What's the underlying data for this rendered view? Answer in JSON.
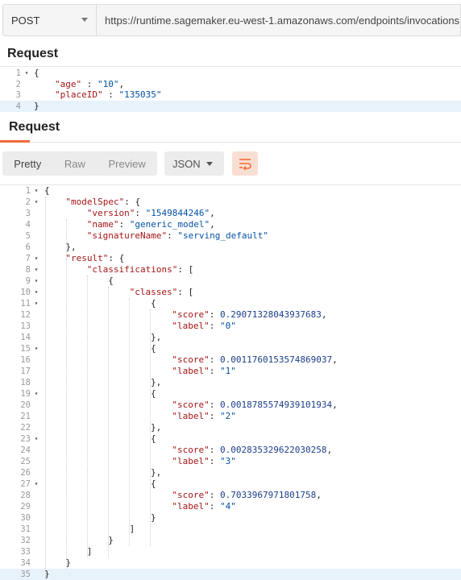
{
  "request_bar": {
    "method": "POST",
    "url": "https://runtime.sagemaker.eu-west-1.amazonaws.com/endpoints/invocations"
  },
  "request_section": {
    "heading": "Request",
    "lines": [
      {
        "num": "1",
        "fold": true,
        "text": "{"
      },
      {
        "num": "2",
        "fold": false,
        "key": "\"age\"",
        "sep": " : ",
        "val": "\"10\"",
        "tail": ","
      },
      {
        "num": "3",
        "fold": false,
        "key": "\"placeID\"",
        "sep": " : ",
        "val": "\"135035\"",
        "tail": ""
      },
      {
        "num": "4",
        "fold": false,
        "text": "}"
      }
    ]
  },
  "response_section": {
    "heading": "Request",
    "view_tabs": [
      "Pretty",
      "Raw",
      "Preview"
    ],
    "format": "JSON",
    "wrap_icon": "wrap-lines-icon",
    "accent_color": "#f26b3a",
    "lines": [
      {
        "num": "1",
        "fold": true,
        "indent": 0,
        "text": "{"
      },
      {
        "num": "2",
        "fold": true,
        "indent": 1,
        "key": "\"modelSpec\"",
        "sep": ": ",
        "text": "{"
      },
      {
        "num": "3",
        "fold": false,
        "indent": 2,
        "key": "\"version\"",
        "sep": ": ",
        "val": "\"1549844246\"",
        "tail": ","
      },
      {
        "num": "4",
        "fold": false,
        "indent": 2,
        "key": "\"name\"",
        "sep": ": ",
        "val": "\"generic_model\"",
        "tail": ","
      },
      {
        "num": "5",
        "fold": false,
        "indent": 2,
        "key": "\"signatureName\"",
        "sep": ": ",
        "val": "\"serving_default\"",
        "tail": ""
      },
      {
        "num": "6",
        "fold": false,
        "indent": 1,
        "text": "},"
      },
      {
        "num": "7",
        "fold": true,
        "indent": 1,
        "key": "\"result\"",
        "sep": ": ",
        "text": "{"
      },
      {
        "num": "8",
        "fold": true,
        "indent": 2,
        "key": "\"classifications\"",
        "sep": ": ",
        "text": "["
      },
      {
        "num": "9",
        "fold": true,
        "indent": 3,
        "text": "{"
      },
      {
        "num": "10",
        "fold": true,
        "indent": 4,
        "key": "\"classes\"",
        "sep": ": ",
        "text": "["
      },
      {
        "num": "11",
        "fold": true,
        "indent": 5,
        "text": "{"
      },
      {
        "num": "12",
        "fold": false,
        "indent": 6,
        "key": "\"score\"",
        "sep": ": ",
        "num_val": "0.29071328043937683",
        "tail": ","
      },
      {
        "num": "13",
        "fold": false,
        "indent": 6,
        "key": "\"label\"",
        "sep": ": ",
        "val": "\"0\"",
        "tail": ""
      },
      {
        "num": "14",
        "fold": false,
        "indent": 5,
        "text": "},"
      },
      {
        "num": "15",
        "fold": true,
        "indent": 5,
        "text": "{"
      },
      {
        "num": "16",
        "fold": false,
        "indent": 6,
        "key": "\"score\"",
        "sep": ": ",
        "num_val": "0.0011760153574869037",
        "tail": ","
      },
      {
        "num": "17",
        "fold": false,
        "indent": 6,
        "key": "\"label\"",
        "sep": ": ",
        "val": "\"1\"",
        "tail": ""
      },
      {
        "num": "18",
        "fold": false,
        "indent": 5,
        "text": "},"
      },
      {
        "num": "19",
        "fold": true,
        "indent": 5,
        "text": "{"
      },
      {
        "num": "20",
        "fold": false,
        "indent": 6,
        "key": "\"score\"",
        "sep": ": ",
        "num_val": "0.0018785574939101934",
        "tail": ","
      },
      {
        "num": "21",
        "fold": false,
        "indent": 6,
        "key": "\"label\"",
        "sep": ": ",
        "val": "\"2\"",
        "tail": ""
      },
      {
        "num": "22",
        "fold": false,
        "indent": 5,
        "text": "},"
      },
      {
        "num": "23",
        "fold": true,
        "indent": 5,
        "text": "{"
      },
      {
        "num": "24",
        "fold": false,
        "indent": 6,
        "key": "\"score\"",
        "sep": ": ",
        "num_val": "0.002835329622030258",
        "tail": ","
      },
      {
        "num": "25",
        "fold": false,
        "indent": 6,
        "key": "\"label\"",
        "sep": ": ",
        "val": "\"3\"",
        "tail": ""
      },
      {
        "num": "26",
        "fold": false,
        "indent": 5,
        "text": "},"
      },
      {
        "num": "27",
        "fold": true,
        "indent": 5,
        "text": "{"
      },
      {
        "num": "28",
        "fold": false,
        "indent": 6,
        "key": "\"score\"",
        "sep": ": ",
        "num_val": "0.7033967971801758",
        "tail": ","
      },
      {
        "num": "29",
        "fold": false,
        "indent": 6,
        "key": "\"label\"",
        "sep": ": ",
        "val": "\"4\"",
        "tail": ""
      },
      {
        "num": "30",
        "fold": false,
        "indent": 5,
        "text": "}"
      },
      {
        "num": "31",
        "fold": false,
        "indent": 4,
        "text": "]"
      },
      {
        "num": "32",
        "fold": false,
        "indent": 3,
        "text": "}"
      },
      {
        "num": "33",
        "fold": false,
        "indent": 2,
        "text": "]"
      },
      {
        "num": "34",
        "fold": false,
        "indent": 1,
        "text": "}"
      },
      {
        "num": "35",
        "fold": false,
        "indent": 0,
        "text": "}"
      }
    ]
  }
}
